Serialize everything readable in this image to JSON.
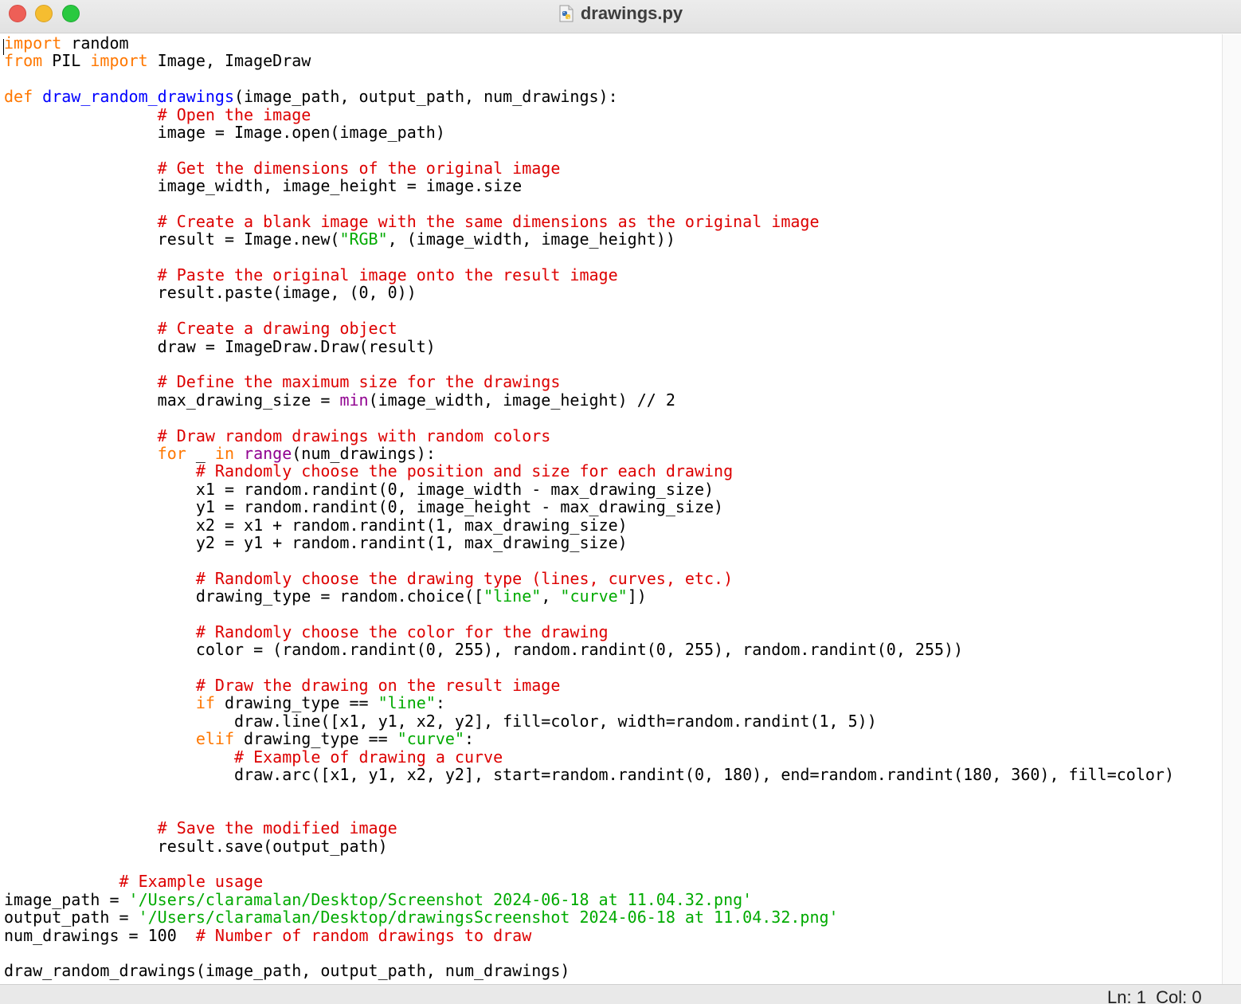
{
  "window": {
    "title": "drawings.py",
    "file_icon": "python-file-icon"
  },
  "syntax_colors": {
    "keyword": "#ff7700",
    "function_name": "#0000ff",
    "comment": "#dd0000",
    "string": "#00aa00",
    "builtin": "#900090",
    "default": "#000000"
  },
  "code_lines": [
    [
      [
        "kw",
        "import"
      ],
      [
        "pl",
        " random"
      ]
    ],
    [
      [
        "kw",
        "from"
      ],
      [
        "pl",
        " PIL "
      ],
      [
        "kw",
        "import"
      ],
      [
        "pl",
        " Image, ImageDraw"
      ]
    ],
    [],
    [
      [
        "kw",
        "def"
      ],
      [
        "pl",
        " "
      ],
      [
        "fn",
        "draw_random_drawings"
      ],
      [
        "pl",
        "(image_path, output_path, num_drawings):"
      ]
    ],
    [
      [
        "pl",
        "                "
      ],
      [
        "cm",
        "# Open the image"
      ]
    ],
    [
      [
        "pl",
        "                image = Image.open(image_path)"
      ]
    ],
    [],
    [
      [
        "pl",
        "                "
      ],
      [
        "cm",
        "# Get the dimensions of the original image"
      ]
    ],
    [
      [
        "pl",
        "                image_width, image_height = image.size"
      ]
    ],
    [],
    [
      [
        "pl",
        "                "
      ],
      [
        "cm",
        "# Create a blank image with the same dimensions as the original image"
      ]
    ],
    [
      [
        "pl",
        "                result = Image.new("
      ],
      [
        "st",
        "\"RGB\""
      ],
      [
        "pl",
        ", (image_width, image_height))"
      ]
    ],
    [],
    [
      [
        "pl",
        "                "
      ],
      [
        "cm",
        "# Paste the original image onto the result image"
      ]
    ],
    [
      [
        "pl",
        "                result.paste(image, (0, 0))"
      ]
    ],
    [],
    [
      [
        "pl",
        "                "
      ],
      [
        "cm",
        "# Create a drawing object"
      ]
    ],
    [
      [
        "pl",
        "                draw = ImageDraw.Draw(result)"
      ]
    ],
    [],
    [
      [
        "pl",
        "                "
      ],
      [
        "cm",
        "# Define the maximum size for the drawings"
      ]
    ],
    [
      [
        "pl",
        "                max_drawing_size = "
      ],
      [
        "bi",
        "min"
      ],
      [
        "pl",
        "(image_width, image_height) // 2"
      ]
    ],
    [],
    [
      [
        "pl",
        "                "
      ],
      [
        "cm",
        "# Draw random drawings with random colors"
      ]
    ],
    [
      [
        "pl",
        "                "
      ],
      [
        "kw",
        "for"
      ],
      [
        "pl",
        " _ "
      ],
      [
        "kw",
        "in"
      ],
      [
        "pl",
        " "
      ],
      [
        "bi",
        "range"
      ],
      [
        "pl",
        "(num_drawings):"
      ]
    ],
    [
      [
        "pl",
        "                    "
      ],
      [
        "cm",
        "# Randomly choose the position and size for each drawing"
      ]
    ],
    [
      [
        "pl",
        "                    x1 = random.randint(0, image_width - max_drawing_size)"
      ]
    ],
    [
      [
        "pl",
        "                    y1 = random.randint(0, image_height - max_drawing_size)"
      ]
    ],
    [
      [
        "pl",
        "                    x2 = x1 + random.randint(1, max_drawing_size)"
      ]
    ],
    [
      [
        "pl",
        "                    y2 = y1 + random.randint(1, max_drawing_size)"
      ]
    ],
    [],
    [
      [
        "pl",
        "                    "
      ],
      [
        "cm",
        "# Randomly choose the drawing type (lines, curves, etc.)"
      ]
    ],
    [
      [
        "pl",
        "                    drawing_type = random.choice(["
      ],
      [
        "st",
        "\"line\""
      ],
      [
        "pl",
        ", "
      ],
      [
        "st",
        "\"curve\""
      ],
      [
        "pl",
        "])"
      ]
    ],
    [],
    [
      [
        "pl",
        "                    "
      ],
      [
        "cm",
        "# Randomly choose the color for the drawing"
      ]
    ],
    [
      [
        "pl",
        "                    color = (random.randint(0, 255), random.randint(0, 255), random.randint(0, 255))"
      ]
    ],
    [],
    [
      [
        "pl",
        "                    "
      ],
      [
        "cm",
        "# Draw the drawing on the result image"
      ]
    ],
    [
      [
        "pl",
        "                    "
      ],
      [
        "kw",
        "if"
      ],
      [
        "pl",
        " drawing_type == "
      ],
      [
        "st",
        "\"line\""
      ],
      [
        "pl",
        ":"
      ]
    ],
    [
      [
        "pl",
        "                        draw.line([x1, y1, x2, y2], fill=color, width=random.randint(1, 5))"
      ]
    ],
    [
      [
        "pl",
        "                    "
      ],
      [
        "kw",
        "elif"
      ],
      [
        "pl",
        " drawing_type == "
      ],
      [
        "st",
        "\"curve\""
      ],
      [
        "pl",
        ":"
      ]
    ],
    [
      [
        "pl",
        "                        "
      ],
      [
        "cm",
        "# Example of drawing a curve"
      ]
    ],
    [
      [
        "pl",
        "                        draw.arc([x1, y1, x2, y2], start=random.randint(0, 180), end=random.randint(180, 360), fill=color)"
      ]
    ],
    [],
    [],
    [
      [
        "pl",
        "                "
      ],
      [
        "cm",
        "# Save the modified image"
      ]
    ],
    [
      [
        "pl",
        "                result.save(output_path)"
      ]
    ],
    [],
    [
      [
        "pl",
        "            "
      ],
      [
        "cm",
        "# Example usage"
      ]
    ],
    [
      [
        "pl",
        "image_path = "
      ],
      [
        "st",
        "'/Users/claramalan/Desktop/Screenshot 2024-06-18 at 11.04.32.png'"
      ]
    ],
    [
      [
        "pl",
        "output_path = "
      ],
      [
        "st",
        "'/Users/claramalan/Desktop/drawingsScreenshot 2024-06-18 at 11.04.32.png'"
      ]
    ],
    [
      [
        "pl",
        "num_drawings = 100  "
      ],
      [
        "cm",
        "# Number of random drawings to draw"
      ]
    ],
    [],
    [
      [
        "pl",
        "draw_random_drawings(image_path, output_path, num_drawings)"
      ]
    ]
  ],
  "status": {
    "position": "Ln: 1  Col: 0"
  }
}
